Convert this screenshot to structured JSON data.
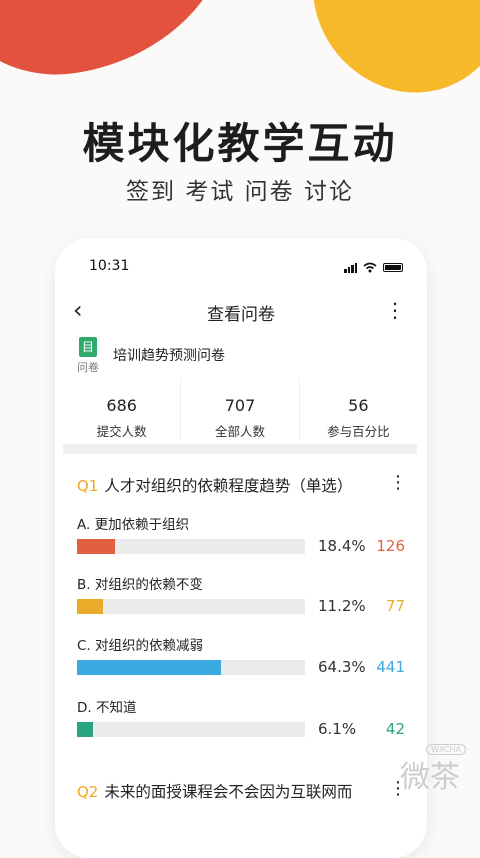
{
  "headline": "模块化教学互动",
  "subhead": "签到 考试 问卷 讨论",
  "phone": {
    "status_time": "10:31",
    "nav": {
      "title": "查看问卷"
    },
    "survey": {
      "icon_text": "目",
      "tag": "问卷",
      "name": "培训趋势预测问卷"
    },
    "stats": [
      {
        "num": "686",
        "label": "提交人数"
      },
      {
        "num": "707",
        "label": "全部人数"
      },
      {
        "num": "56",
        "label": "参与百分比"
      }
    ],
    "q1": {
      "num": "Q1",
      "title": "人才对组织的依赖程度趋势（单选）",
      "options": [
        {
          "label": "A. 更加依赖于组织",
          "pct": "18.4%",
          "count": "126",
          "color": "#e0603f",
          "fill": 0.167
        },
        {
          "label": "B. 对组织的依赖不变",
          "pct": "11.2%",
          "count": "77",
          "color": "#e8ac2a",
          "fill": 0.115
        },
        {
          "label": "C. 对组织的依赖减弱",
          "pct": "64.3%",
          "count": "441",
          "color": "#39a9df",
          "fill": 0.63
        },
        {
          "label": "D. 不知道",
          "pct": "6.1%",
          "count": "42",
          "color": "#2aa383",
          "fill": 0.07
        }
      ]
    },
    "q2": {
      "num": "Q2",
      "title": "未来的面授课程会不会因为互联网而"
    }
  },
  "watermark": {
    "text": "微茶",
    "small": "WXCHA"
  },
  "colors": {
    "red_blob": "#e2523f",
    "yellow_blob": "#f7b82a",
    "accent": "#f2a620"
  }
}
